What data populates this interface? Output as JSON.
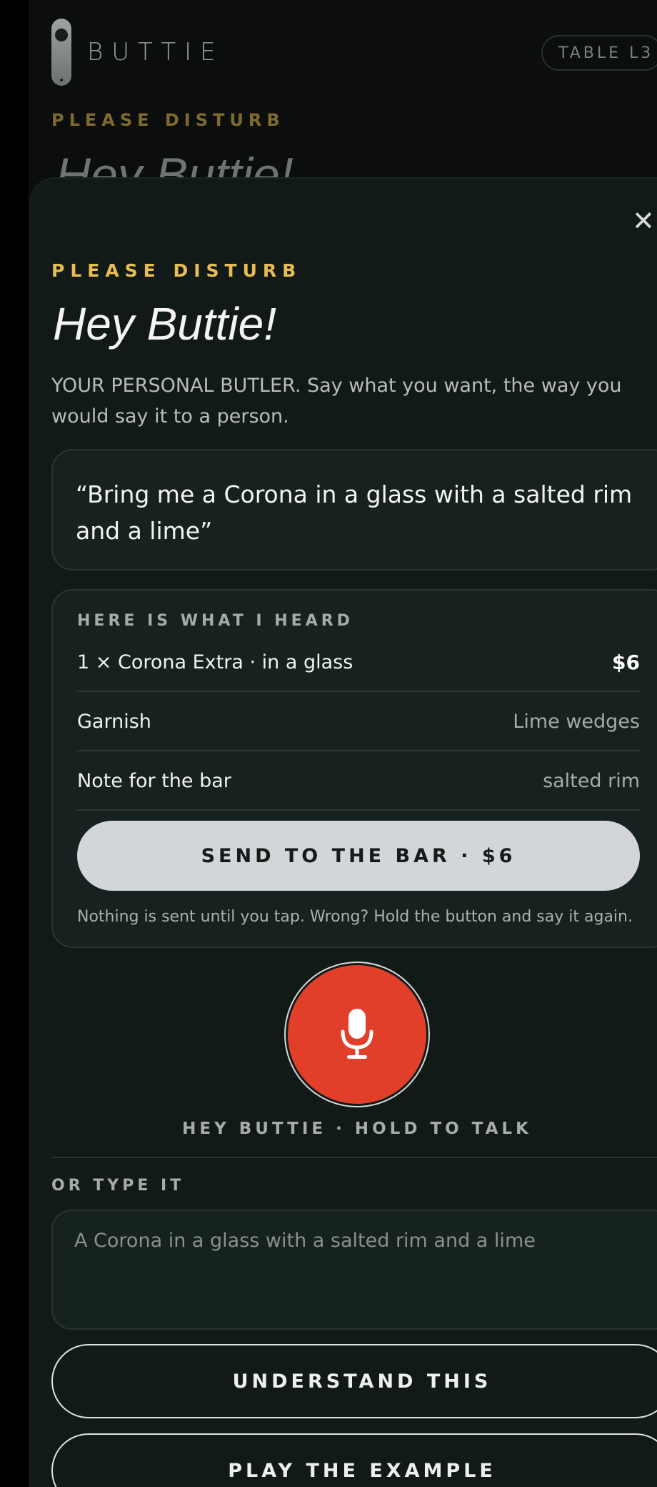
{
  "header": {
    "brand_name": "BUTTIE",
    "table_label": "TABLE L3",
    "bg_eyebrow": "PLEASE DISTURB",
    "bg_title": "Hey Buttie!"
  },
  "sheet": {
    "close_glyph": "✕",
    "eyebrow": "PLEASE DISTURB",
    "title": "Hey Buttie!",
    "subtitle": "YOUR PERSONAL BUTLER. Say what you want, the way you would say it to a person.",
    "quote": "“Bring me a Corona in a glass with a salted rim and a lime”"
  },
  "heard": {
    "title": "HERE IS WHAT I HEARD",
    "rows": [
      {
        "label": "1 × Corona Extra · in a glass",
        "value": "$6"
      },
      {
        "label": "Garnish",
        "value": "Lime wedges"
      },
      {
        "label": "Note for the bar",
        "value": "salted rim"
      }
    ],
    "send_label": "SEND TO THE BAR · $6",
    "note": "Nothing is sent until you tap. Wrong? Hold the button and say it again."
  },
  "mic": {
    "icon": "microphone-icon",
    "label": "HEY BUTTIE · HOLD TO TALK"
  },
  "type": {
    "label": "OR TYPE IT",
    "placeholder": "A Corona in a glass with a salted rim and a lime"
  },
  "actions": {
    "understand_label": "UNDERSTAND THIS",
    "example_label": "PLAY THE EXAMPLE"
  },
  "colors": {
    "accent_gold": "#e9bd52",
    "mic_red": "#e23f2b",
    "surface": "#121a18"
  }
}
